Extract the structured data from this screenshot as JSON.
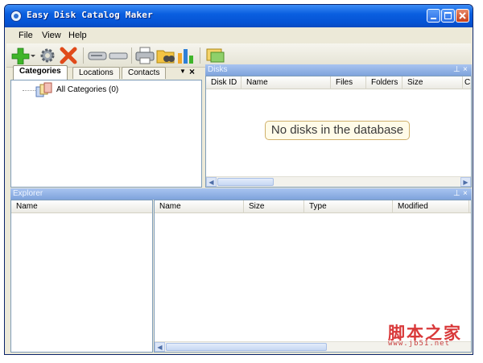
{
  "window": {
    "title": "Easy Disk Catalog Maker"
  },
  "menu": {
    "items": [
      "File",
      "View",
      "Help"
    ]
  },
  "toolbar": {
    "buttons": [
      "add-icon",
      "settings-icon",
      "delete-icon",
      "disk-icon",
      "disk-flat-icon",
      "print-icon",
      "find-icon",
      "chart-icon",
      "info-icon"
    ]
  },
  "left_panel": {
    "tabs": [
      "Categories",
      "Locations",
      "Contacts"
    ],
    "tree_root": "All Categories (0)"
  },
  "disks_panel": {
    "title": "Disks",
    "columns": [
      "Disk ID",
      "Name",
      "Files",
      "Folders",
      "Size",
      "C"
    ],
    "empty_message": "No disks in the database"
  },
  "explorer_panel": {
    "title": "Explorer",
    "tree_column": "Name",
    "columns": [
      "Name",
      "Size",
      "Type",
      "Modified"
    ]
  },
  "watermark": {
    "chinese": "脚本之家",
    "url": "www.jb51.net"
  },
  "colors": {
    "title_bar": "#0553d4",
    "panel_head": "#7ea3dc",
    "accent_green": "#3fb52a",
    "accent_red": "#e04a1a"
  }
}
